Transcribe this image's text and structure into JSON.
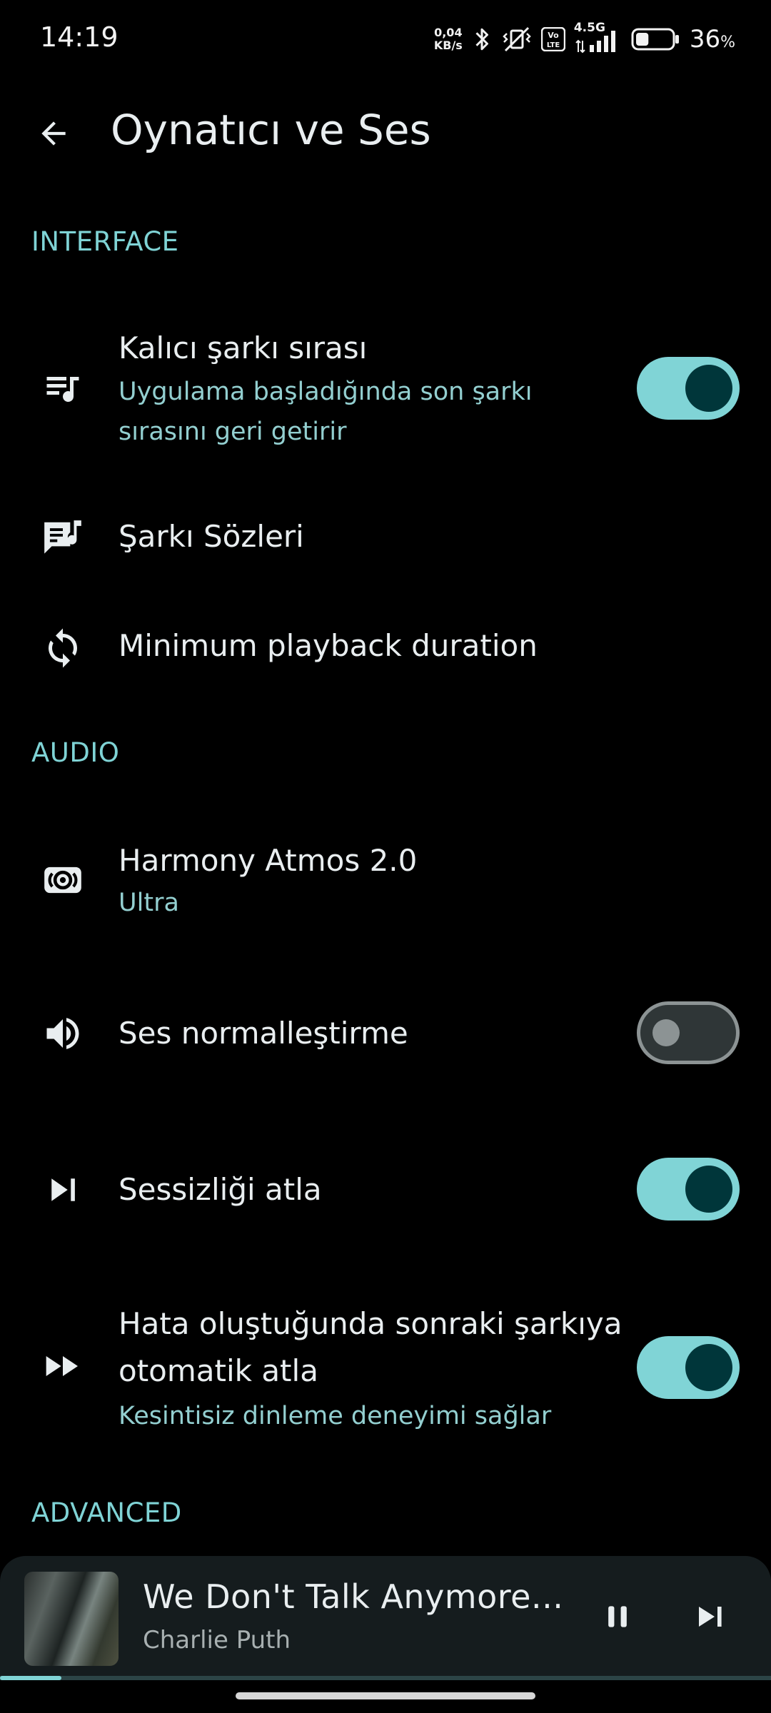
{
  "status_bar": {
    "time": "14:19",
    "net_speed_value": "0,04",
    "net_speed_unit": "KB/s",
    "network_type": "4.5G",
    "volte_label": "Vo LTE",
    "battery_percent": "36",
    "battery_unit": "%",
    "battery_level": 0.36
  },
  "header": {
    "title": "Oynatıcı ve Ses",
    "back_icon": "arrow-left-icon"
  },
  "sections": {
    "interface": "INTERFACE",
    "audio": "AUDIO",
    "advanced": "ADVANCED"
  },
  "settings": {
    "persistent_queue": {
      "icon": "queue-music-icon",
      "title": "Kalıcı şarkı sırası",
      "subtitle_line1": "Uygulama başladığında son şarkı",
      "subtitle_line2": "sırasını geri getirir",
      "enabled": true
    },
    "lyrics": {
      "icon": "lyrics-icon",
      "title": "Şarkı Sözleri"
    },
    "min_playback": {
      "icon": "sync-icon",
      "title": "Minimum playback duration"
    },
    "harmony_atmos": {
      "icon": "surround-sound-icon",
      "title": "Harmony Atmos 2.0",
      "subtitle": "Ultra"
    },
    "normalization": {
      "icon": "volume-icon",
      "title": "Ses normalleştirme",
      "enabled": false
    },
    "skip_silence": {
      "icon": "skip-next-icon",
      "title": "Sessizliği atla",
      "enabled": true
    },
    "auto_skip_error": {
      "icon": "fast-forward-icon",
      "title_line1": "Hata oluştuğunda sonraki şarkıya",
      "title_line2": "otomatik atla",
      "subtitle": "Kesintisiz dinleme deneyimi sağlar",
      "enabled": true
    }
  },
  "mini_player": {
    "track_title": "We Don't Talk Anymore...",
    "artist": "Charlie Puth",
    "progress": 0.08,
    "pause_icon": "pause-icon",
    "next_icon": "skip-next-icon"
  },
  "colors": {
    "accent": "#80d4d6",
    "background": "#000000",
    "toggle_knob_on": "#00363a",
    "toggle_off_outline": "#8c9394"
  }
}
